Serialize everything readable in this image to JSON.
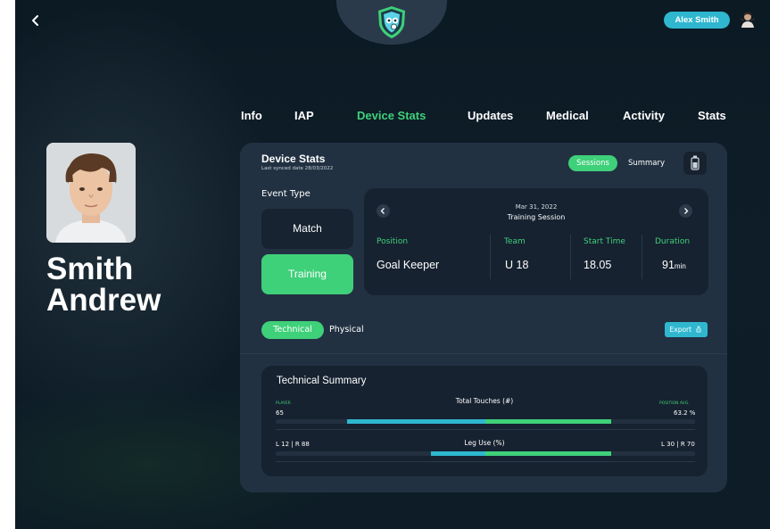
{
  "header": {
    "user_name": "Alex Smith"
  },
  "nav": {
    "tabs": [
      {
        "label": "Info"
      },
      {
        "label": "IAP"
      },
      {
        "label": "Device Stats",
        "active": true
      },
      {
        "label": "Updates"
      },
      {
        "label": "Medical"
      },
      {
        "label": "Activity"
      },
      {
        "label": "Stats"
      }
    ]
  },
  "player": {
    "last_name": "Smith",
    "first_name": "Andrew"
  },
  "device_stats": {
    "title": "Device Stats",
    "last_synced": "Last synced date 28/03/2022",
    "view_toggle": {
      "sessions": "Sessions",
      "summary": "Summary",
      "selected": "Sessions"
    },
    "event_type_label": "Event Type",
    "event_types": [
      {
        "label": "Match",
        "selected": false
      },
      {
        "label": "Training",
        "selected": true
      }
    ],
    "session": {
      "date": "Mar 31, 2022",
      "type": "Training Session",
      "columns": [
        {
          "label": "Position",
          "value": "Goal Keeper"
        },
        {
          "label": "Team",
          "value": "U 18"
        },
        {
          "label": "Start Time",
          "value": "18.05"
        },
        {
          "label": "Duration",
          "value": "91",
          "unit": "min"
        }
      ]
    },
    "category_tabs": {
      "technical": "Technical",
      "physical": "Physical",
      "selected": "Technical"
    },
    "export_label": "Export",
    "technical_summary": {
      "title": "Technical Summary",
      "player_label": "PLAYER",
      "position_avg_label": "POSITION AVG.",
      "metrics": [
        {
          "label": "Total Touches (#)",
          "player": "65",
          "position_avg": "63.2 %",
          "player_share": 0.33,
          "avg_share": 0.3
        },
        {
          "label": "Leg Use (%)",
          "player": "L 12 | R 88",
          "position_avg": "L 30 | R 70",
          "player_share": 0.13,
          "avg_share": 0.3
        }
      ]
    }
  },
  "colors": {
    "accent_green": "#3fd07a",
    "accent_cyan": "#2fb7cf",
    "panel": "#223142",
    "card": "#162230",
    "background": "#0f1d29"
  },
  "icons": [
    "back-chevron-icon",
    "team-crest-logo",
    "user-avatar-icon",
    "phone-device-icon",
    "chevron-left-icon",
    "chevron-right-icon",
    "export-icon"
  ]
}
